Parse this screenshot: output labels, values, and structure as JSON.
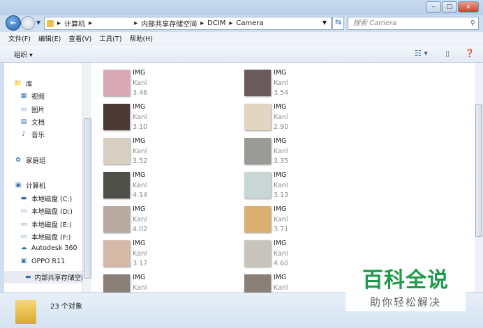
{
  "window": {
    "minimize": "–",
    "maximize": "□",
    "close": "x"
  },
  "address": {
    "segments": [
      "计算机",
      "",
      "内部共享存储空间",
      "DCIM",
      "Camera"
    ],
    "search_placeholder": "搜索 Camera"
  },
  "menu": [
    "文件(F)",
    "编辑(E)",
    "查看(V)",
    "工具(T)",
    "帮助(H)"
  ],
  "toolbar": {
    "organize": "组织 ▾"
  },
  "sidebar": [
    {
      "label": "库",
      "icon": "library-icon"
    },
    {
      "label": "视频",
      "icon": "video-icon"
    },
    {
      "label": "图片",
      "icon": "pictures-icon"
    },
    {
      "label": "文档",
      "icon": "documents-icon"
    },
    {
      "label": "音乐",
      "icon": "music-icon"
    },
    {
      "label": "家庭组",
      "icon": "homegroup-icon"
    },
    {
      "label": "计算机",
      "icon": "computer-icon"
    },
    {
      "label": "本地磁盘 (C:)",
      "icon": "drive-c-icon"
    },
    {
      "label": "本地磁盘 (D:)",
      "icon": "drive-icon"
    },
    {
      "label": "本地磁盘 (E:)",
      "icon": "drive-icon"
    },
    {
      "label": "本地磁盘 (F:)",
      "icon": "drive-icon"
    },
    {
      "label": "Autodesk 360",
      "icon": "cloud-icon"
    },
    {
      "label": "OPPO R11",
      "icon": "phone-icon"
    },
    {
      "label": "内部共享存储空间",
      "icon": "storage-icon"
    }
  ],
  "files": [
    {
      "name": "IMG",
      "type": "Kanl",
      "size": "3.46",
      "color": "#d9a9b5"
    },
    {
      "name": "IMG",
      "type": "Kanl",
      "size": "3.54",
      "color": "#6d5a5a"
    },
    {
      "name": "IMG",
      "type": "Kanl",
      "size": "3.10",
      "color": "#4a3a33"
    },
    {
      "name": "IMG",
      "type": "Kanl",
      "size": "2.90",
      "color": "#e2d6c0"
    },
    {
      "name": "IMG",
      "type": "Kanl",
      "size": "3.52",
      "color": "#d7cfc2"
    },
    {
      "name": "IMG",
      "type": "Kanl",
      "size": "3.35",
      "color": "#9a9a96"
    },
    {
      "name": "IMG",
      "type": "Kanl",
      "size": "4.14",
      "color": "#50504a"
    },
    {
      "name": "IMG",
      "type": "Kanl",
      "size": "3.13",
      "color": "#c9d6d6"
    },
    {
      "name": "IMG",
      "type": "Kanl",
      "size": "4.02",
      "color": "#b8aaa0"
    },
    {
      "name": "IMG",
      "type": "Kanl",
      "size": "3.71",
      "color": "#d9b070"
    },
    {
      "name": "IMG",
      "type": "Kanl",
      "size": "3.17",
      "color": "#d5b8a8"
    },
    {
      "name": "IMG",
      "type": "Kanl",
      "size": "4.60",
      "color": "#c8c4bc"
    },
    {
      "name": "IMG",
      "type": "Kanl",
      "size": "",
      "color": "#8a8078"
    },
    {
      "name": "IMG",
      "type": "Kanl",
      "size": "",
      "color": "#8a8078"
    }
  ],
  "status": {
    "count": "23 个对象"
  },
  "watermark": {
    "title": "百科全说",
    "subtitle": "助你轻松解决"
  }
}
